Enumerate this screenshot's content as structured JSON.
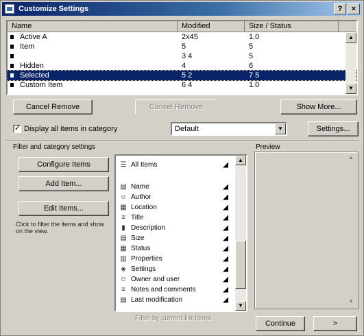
{
  "window": {
    "title": "Customize Settings",
    "help_label": "?",
    "close_label": "×"
  },
  "list": {
    "columns": [
      "Name",
      "Modified",
      "Size / Status"
    ],
    "rows": [
      {
        "name": "Active A",
        "a": "2x45",
        "b": "1.0"
      },
      {
        "name": "Item",
        "a": "5",
        "b": "5"
      },
      {
        "name": "",
        "a": "3 4",
        "b": "5"
      },
      {
        "name": "Hidden",
        "a": "4",
        "b": "6"
      },
      {
        "name": "Selected",
        "a": "5 2",
        "b": "7 5"
      },
      {
        "name": "Custom Item",
        "a": "6 4",
        "b": "1.0"
      }
    ],
    "selected_index": 4
  },
  "buttons": {
    "btn1": "Cancel Remove",
    "btn2": "Cancel Remove",
    "btn3": "Show More..."
  },
  "option_row": {
    "checkbox_label": "Display all items in category",
    "select_value": "Default",
    "more_label": "Settings..."
  },
  "section": {
    "left_heading": "Filter and category settings",
    "right_heading": "Preview"
  },
  "left_buttons": {
    "b1": "Configure Items",
    "b2": "Add Item...",
    "b3": "Edit Items..."
  },
  "note": "Click to filter the items and show on the view.",
  "filter": {
    "items": [
      {
        "icon": "list-icon",
        "glyph": "☰",
        "text": "All Items"
      },
      {
        "icon": "doc-icon",
        "glyph": "▤",
        "text": "Name"
      },
      {
        "icon": "person-icon",
        "glyph": "☺",
        "text": "Author"
      },
      {
        "icon": "page-icon",
        "glyph": "▦",
        "text": "Location"
      },
      {
        "icon": "lines-icon",
        "glyph": "≡",
        "text": "Title"
      },
      {
        "icon": "bar-icon",
        "glyph": "▮",
        "text": "Description"
      },
      {
        "icon": "doc-icon",
        "glyph": "▤",
        "text": "Size"
      },
      {
        "icon": "grid-icon",
        "glyph": "▦",
        "text": "Status"
      },
      {
        "icon": "chart-icon",
        "glyph": "▥",
        "text": "Properties"
      },
      {
        "icon": "tag-icon",
        "glyph": "◈",
        "text": "Settings"
      },
      {
        "icon": "person-icon",
        "glyph": "☺",
        "text": "Owner and user"
      },
      {
        "icon": "lines-icon",
        "glyph": "≡",
        "text": "Notes and comments"
      },
      {
        "icon": "doc-icon",
        "glyph": "▤",
        "text": "Last modification"
      }
    ],
    "footer": "Filter by current list items"
  },
  "footer_buttons": {
    "ok": "Continue",
    "next": ">"
  }
}
